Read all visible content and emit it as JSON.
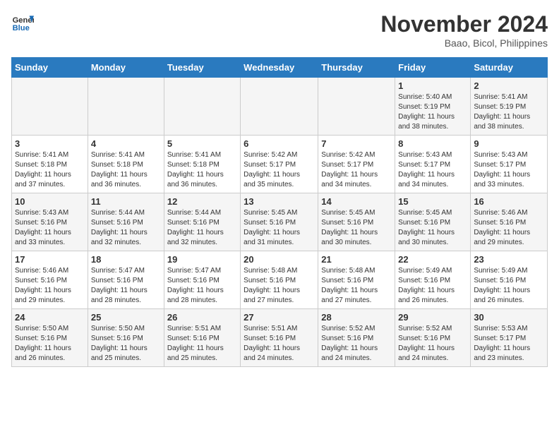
{
  "header": {
    "logo_line1": "General",
    "logo_line2": "Blue",
    "month": "November 2024",
    "location": "Baao, Bicol, Philippines"
  },
  "weekdays": [
    "Sunday",
    "Monday",
    "Tuesday",
    "Wednesday",
    "Thursday",
    "Friday",
    "Saturday"
  ],
  "weeks": [
    [
      {
        "day": "",
        "info": ""
      },
      {
        "day": "",
        "info": ""
      },
      {
        "day": "",
        "info": ""
      },
      {
        "day": "",
        "info": ""
      },
      {
        "day": "",
        "info": ""
      },
      {
        "day": "1",
        "info": "Sunrise: 5:40 AM\nSunset: 5:19 PM\nDaylight: 11 hours\nand 38 minutes."
      },
      {
        "day": "2",
        "info": "Sunrise: 5:41 AM\nSunset: 5:19 PM\nDaylight: 11 hours\nand 38 minutes."
      }
    ],
    [
      {
        "day": "3",
        "info": "Sunrise: 5:41 AM\nSunset: 5:18 PM\nDaylight: 11 hours\nand 37 minutes."
      },
      {
        "day": "4",
        "info": "Sunrise: 5:41 AM\nSunset: 5:18 PM\nDaylight: 11 hours\nand 36 minutes."
      },
      {
        "day": "5",
        "info": "Sunrise: 5:41 AM\nSunset: 5:18 PM\nDaylight: 11 hours\nand 36 minutes."
      },
      {
        "day": "6",
        "info": "Sunrise: 5:42 AM\nSunset: 5:17 PM\nDaylight: 11 hours\nand 35 minutes."
      },
      {
        "day": "7",
        "info": "Sunrise: 5:42 AM\nSunset: 5:17 PM\nDaylight: 11 hours\nand 34 minutes."
      },
      {
        "day": "8",
        "info": "Sunrise: 5:43 AM\nSunset: 5:17 PM\nDaylight: 11 hours\nand 34 minutes."
      },
      {
        "day": "9",
        "info": "Sunrise: 5:43 AM\nSunset: 5:17 PM\nDaylight: 11 hours\nand 33 minutes."
      }
    ],
    [
      {
        "day": "10",
        "info": "Sunrise: 5:43 AM\nSunset: 5:16 PM\nDaylight: 11 hours\nand 33 minutes."
      },
      {
        "day": "11",
        "info": "Sunrise: 5:44 AM\nSunset: 5:16 PM\nDaylight: 11 hours\nand 32 minutes."
      },
      {
        "day": "12",
        "info": "Sunrise: 5:44 AM\nSunset: 5:16 PM\nDaylight: 11 hours\nand 32 minutes."
      },
      {
        "day": "13",
        "info": "Sunrise: 5:45 AM\nSunset: 5:16 PM\nDaylight: 11 hours\nand 31 minutes."
      },
      {
        "day": "14",
        "info": "Sunrise: 5:45 AM\nSunset: 5:16 PM\nDaylight: 11 hours\nand 30 minutes."
      },
      {
        "day": "15",
        "info": "Sunrise: 5:45 AM\nSunset: 5:16 PM\nDaylight: 11 hours\nand 30 minutes."
      },
      {
        "day": "16",
        "info": "Sunrise: 5:46 AM\nSunset: 5:16 PM\nDaylight: 11 hours\nand 29 minutes."
      }
    ],
    [
      {
        "day": "17",
        "info": "Sunrise: 5:46 AM\nSunset: 5:16 PM\nDaylight: 11 hours\nand 29 minutes."
      },
      {
        "day": "18",
        "info": "Sunrise: 5:47 AM\nSunset: 5:16 PM\nDaylight: 11 hours\nand 28 minutes."
      },
      {
        "day": "19",
        "info": "Sunrise: 5:47 AM\nSunset: 5:16 PM\nDaylight: 11 hours\nand 28 minutes."
      },
      {
        "day": "20",
        "info": "Sunrise: 5:48 AM\nSunset: 5:16 PM\nDaylight: 11 hours\nand 27 minutes."
      },
      {
        "day": "21",
        "info": "Sunrise: 5:48 AM\nSunset: 5:16 PM\nDaylight: 11 hours\nand 27 minutes."
      },
      {
        "day": "22",
        "info": "Sunrise: 5:49 AM\nSunset: 5:16 PM\nDaylight: 11 hours\nand 26 minutes."
      },
      {
        "day": "23",
        "info": "Sunrise: 5:49 AM\nSunset: 5:16 PM\nDaylight: 11 hours\nand 26 minutes."
      }
    ],
    [
      {
        "day": "24",
        "info": "Sunrise: 5:50 AM\nSunset: 5:16 PM\nDaylight: 11 hours\nand 26 minutes."
      },
      {
        "day": "25",
        "info": "Sunrise: 5:50 AM\nSunset: 5:16 PM\nDaylight: 11 hours\nand 25 minutes."
      },
      {
        "day": "26",
        "info": "Sunrise: 5:51 AM\nSunset: 5:16 PM\nDaylight: 11 hours\nand 25 minutes."
      },
      {
        "day": "27",
        "info": "Sunrise: 5:51 AM\nSunset: 5:16 PM\nDaylight: 11 hours\nand 24 minutes."
      },
      {
        "day": "28",
        "info": "Sunrise: 5:52 AM\nSunset: 5:16 PM\nDaylight: 11 hours\nand 24 minutes."
      },
      {
        "day": "29",
        "info": "Sunrise: 5:52 AM\nSunset: 5:16 PM\nDaylight: 11 hours\nand 24 minutes."
      },
      {
        "day": "30",
        "info": "Sunrise: 5:53 AM\nSunset: 5:17 PM\nDaylight: 11 hours\nand 23 minutes."
      }
    ]
  ]
}
